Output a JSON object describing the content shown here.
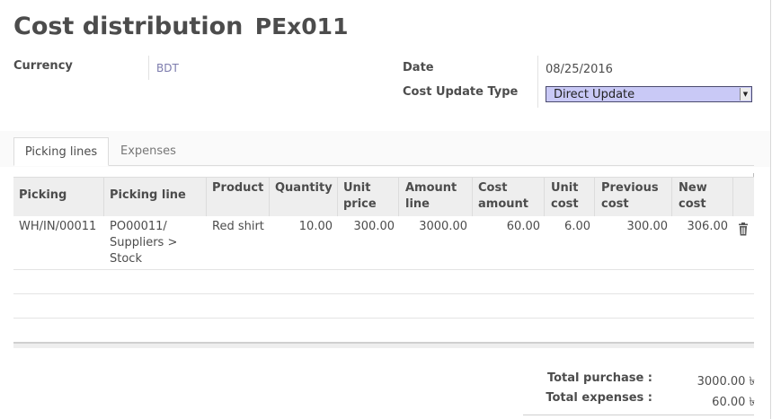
{
  "header": {
    "title": "Cost distribution",
    "reference": "PEx011"
  },
  "fields": {
    "currency": {
      "label": "Currency",
      "value": "BDT"
    },
    "date": {
      "label": "Date",
      "value": "08/25/2016"
    },
    "cost_update_type": {
      "label": "Cost Update Type",
      "value": "Direct Update"
    }
  },
  "tabs": [
    {
      "label": "Picking lines",
      "active": true
    },
    {
      "label": "Expenses",
      "active": false
    }
  ],
  "table": {
    "columns": [
      [
        "Picking"
      ],
      [
        "Picking line"
      ],
      [
        "Product"
      ],
      [
        "Quantity"
      ],
      [
        "Unit",
        "price"
      ],
      [
        "Amount",
        "line"
      ],
      [
        "Cost",
        "amount"
      ],
      [
        "Unit",
        "cost"
      ],
      [
        "Previous",
        "cost"
      ],
      [
        "New",
        "cost"
      ]
    ],
    "rows": [
      {
        "picking": "WH/IN/00011",
        "picking_line": [
          "PO00011/",
          "Suppliers >",
          "Stock"
        ],
        "product": "Red shirt",
        "quantity": "10.00",
        "unit_price": "300.00",
        "amount_line": "3000.00",
        "cost_amount": "60.00",
        "unit_cost": "6.00",
        "previous_cost": "300.00",
        "new_cost": "306.00"
      }
    ],
    "row_action_icon": "trash-icon"
  },
  "totals": {
    "purchase_label": "Total purchase :",
    "purchase_value": "3000.00 ৳",
    "expenses_label": "Total expenses :",
    "expenses_value": "60.00 ৳"
  },
  "colors": {
    "link": "#7c7bad",
    "select_bg": "#c9c9f6",
    "header_bg": "#eeeeee"
  }
}
